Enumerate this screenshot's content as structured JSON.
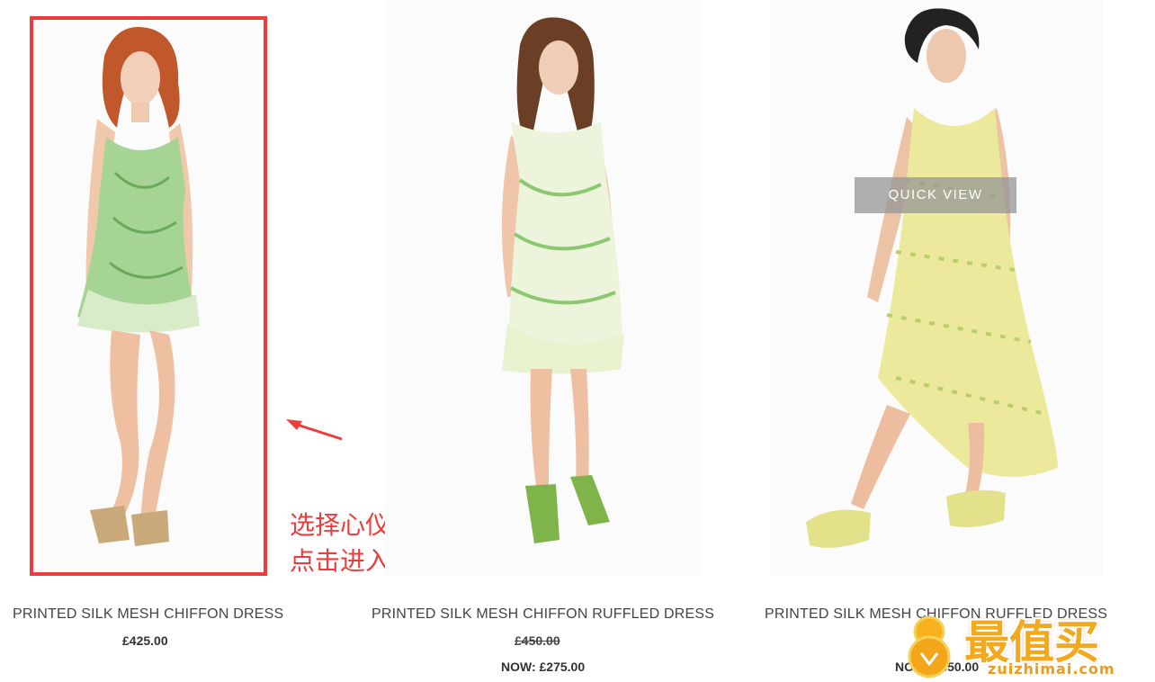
{
  "products": [
    {
      "title": "PRINTED SILK MESH CHIFFON DRESS",
      "price": "£425.00"
    },
    {
      "title": "PRINTED SILK MESH CHIFFON RUFFLED DRESS",
      "old_price": "£450.00",
      "now_price": "NOW: £275.00"
    },
    {
      "title": "PRINTED SILK MESH CHIFFON RUFFLED DRESS",
      "now_price": "NOW: £350.00"
    }
  ],
  "quick_view_label": "QUICK VIEW",
  "annotation": {
    "line1": "选择心仪商品",
    "line2": "点击进入商品页面"
  },
  "watermark": {
    "brand": "最值买",
    "domain": "zuizhimai.com"
  },
  "colors": {
    "highlight": "#ef3b3b",
    "dress_green": "#8fc77a",
    "dress_yellow": "#e9e79a"
  }
}
